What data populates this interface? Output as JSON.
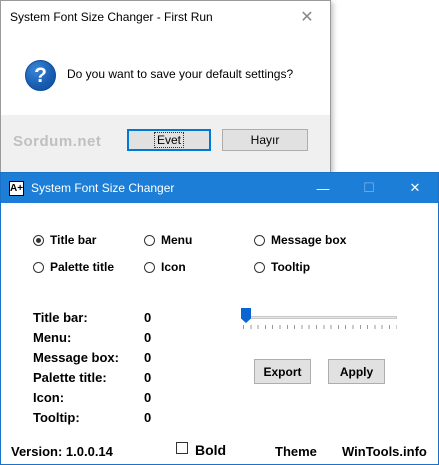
{
  "dialog": {
    "title": "System Font Size Changer - First Run",
    "close_glyph": "✕",
    "message": "Do you want to save your default settings?",
    "watermark": "Sordum.net",
    "yes_label": "Evet",
    "no_label": "Hayır"
  },
  "window": {
    "title": "System Font Size Changer",
    "app_icon_text": "A+",
    "minimize_glyph": "—",
    "maximize_glyph": "☐",
    "close_glyph": "✕"
  },
  "radios": [
    {
      "label": "Title bar",
      "selected": true
    },
    {
      "label": "Menu",
      "selected": false
    },
    {
      "label": "Message box",
      "selected": false
    },
    {
      "label": "Palette title",
      "selected": false
    },
    {
      "label": "Icon",
      "selected": false
    },
    {
      "label": "Tooltip",
      "selected": false
    }
  ],
  "sizes": [
    {
      "label": "Title bar:",
      "value": "0"
    },
    {
      "label": "Menu:",
      "value": "0"
    },
    {
      "label": "Message box:",
      "value": "0"
    },
    {
      "label": "Palette title:",
      "value": "0"
    },
    {
      "label": "Icon:",
      "value": "0"
    },
    {
      "label": "Tooltip:",
      "value": "0"
    }
  ],
  "slider": {
    "value_fraction": 0
  },
  "buttons": {
    "export": "Export",
    "apply": "Apply"
  },
  "footer": {
    "version": "Version: 1.0.0.14",
    "bold_label": "Bold",
    "bold_checked": false,
    "theme": "Theme",
    "site": "WinTools.info"
  },
  "colors": {
    "title_bar": "#1c7ed6",
    "accent": "#0078d7"
  }
}
